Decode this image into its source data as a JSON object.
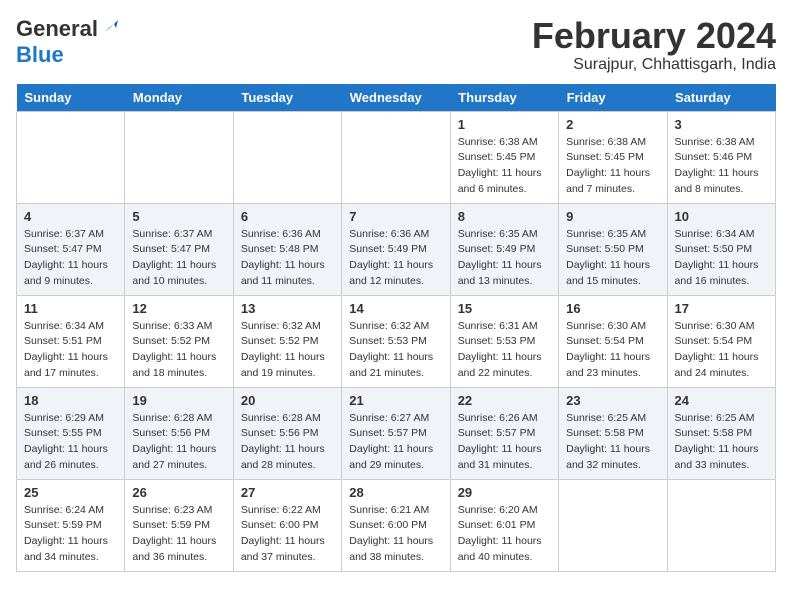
{
  "header": {
    "logo_general": "General",
    "logo_blue": "Blue",
    "month_year": "February 2024",
    "location": "Surajpur, Chhattisgarh, India"
  },
  "weekdays": [
    "Sunday",
    "Monday",
    "Tuesday",
    "Wednesday",
    "Thursday",
    "Friday",
    "Saturday"
  ],
  "weeks": [
    [
      {
        "day": "",
        "info": ""
      },
      {
        "day": "",
        "info": ""
      },
      {
        "day": "",
        "info": ""
      },
      {
        "day": "",
        "info": ""
      },
      {
        "day": "1",
        "info": "Sunrise: 6:38 AM\nSunset: 5:45 PM\nDaylight: 11 hours\nand 6 minutes."
      },
      {
        "day": "2",
        "info": "Sunrise: 6:38 AM\nSunset: 5:45 PM\nDaylight: 11 hours\nand 7 minutes."
      },
      {
        "day": "3",
        "info": "Sunrise: 6:38 AM\nSunset: 5:46 PM\nDaylight: 11 hours\nand 8 minutes."
      }
    ],
    [
      {
        "day": "4",
        "info": "Sunrise: 6:37 AM\nSunset: 5:47 PM\nDaylight: 11 hours\nand 9 minutes."
      },
      {
        "day": "5",
        "info": "Sunrise: 6:37 AM\nSunset: 5:47 PM\nDaylight: 11 hours\nand 10 minutes."
      },
      {
        "day": "6",
        "info": "Sunrise: 6:36 AM\nSunset: 5:48 PM\nDaylight: 11 hours\nand 11 minutes."
      },
      {
        "day": "7",
        "info": "Sunrise: 6:36 AM\nSunset: 5:49 PM\nDaylight: 11 hours\nand 12 minutes."
      },
      {
        "day": "8",
        "info": "Sunrise: 6:35 AM\nSunset: 5:49 PM\nDaylight: 11 hours\nand 13 minutes."
      },
      {
        "day": "9",
        "info": "Sunrise: 6:35 AM\nSunset: 5:50 PM\nDaylight: 11 hours\nand 15 minutes."
      },
      {
        "day": "10",
        "info": "Sunrise: 6:34 AM\nSunset: 5:50 PM\nDaylight: 11 hours\nand 16 minutes."
      }
    ],
    [
      {
        "day": "11",
        "info": "Sunrise: 6:34 AM\nSunset: 5:51 PM\nDaylight: 11 hours\nand 17 minutes."
      },
      {
        "day": "12",
        "info": "Sunrise: 6:33 AM\nSunset: 5:52 PM\nDaylight: 11 hours\nand 18 minutes."
      },
      {
        "day": "13",
        "info": "Sunrise: 6:32 AM\nSunset: 5:52 PM\nDaylight: 11 hours\nand 19 minutes."
      },
      {
        "day": "14",
        "info": "Sunrise: 6:32 AM\nSunset: 5:53 PM\nDaylight: 11 hours\nand 21 minutes."
      },
      {
        "day": "15",
        "info": "Sunrise: 6:31 AM\nSunset: 5:53 PM\nDaylight: 11 hours\nand 22 minutes."
      },
      {
        "day": "16",
        "info": "Sunrise: 6:30 AM\nSunset: 5:54 PM\nDaylight: 11 hours\nand 23 minutes."
      },
      {
        "day": "17",
        "info": "Sunrise: 6:30 AM\nSunset: 5:54 PM\nDaylight: 11 hours\nand 24 minutes."
      }
    ],
    [
      {
        "day": "18",
        "info": "Sunrise: 6:29 AM\nSunset: 5:55 PM\nDaylight: 11 hours\nand 26 minutes."
      },
      {
        "day": "19",
        "info": "Sunrise: 6:28 AM\nSunset: 5:56 PM\nDaylight: 11 hours\nand 27 minutes."
      },
      {
        "day": "20",
        "info": "Sunrise: 6:28 AM\nSunset: 5:56 PM\nDaylight: 11 hours\nand 28 minutes."
      },
      {
        "day": "21",
        "info": "Sunrise: 6:27 AM\nSunset: 5:57 PM\nDaylight: 11 hours\nand 29 minutes."
      },
      {
        "day": "22",
        "info": "Sunrise: 6:26 AM\nSunset: 5:57 PM\nDaylight: 11 hours\nand 31 minutes."
      },
      {
        "day": "23",
        "info": "Sunrise: 6:25 AM\nSunset: 5:58 PM\nDaylight: 11 hours\nand 32 minutes."
      },
      {
        "day": "24",
        "info": "Sunrise: 6:25 AM\nSunset: 5:58 PM\nDaylight: 11 hours\nand 33 minutes."
      }
    ],
    [
      {
        "day": "25",
        "info": "Sunrise: 6:24 AM\nSunset: 5:59 PM\nDaylight: 11 hours\nand 34 minutes."
      },
      {
        "day": "26",
        "info": "Sunrise: 6:23 AM\nSunset: 5:59 PM\nDaylight: 11 hours\nand 36 minutes."
      },
      {
        "day": "27",
        "info": "Sunrise: 6:22 AM\nSunset: 6:00 PM\nDaylight: 11 hours\nand 37 minutes."
      },
      {
        "day": "28",
        "info": "Sunrise: 6:21 AM\nSunset: 6:00 PM\nDaylight: 11 hours\nand 38 minutes."
      },
      {
        "day": "29",
        "info": "Sunrise: 6:20 AM\nSunset: 6:01 PM\nDaylight: 11 hours\nand 40 minutes."
      },
      {
        "day": "",
        "info": ""
      },
      {
        "day": "",
        "info": ""
      }
    ]
  ]
}
